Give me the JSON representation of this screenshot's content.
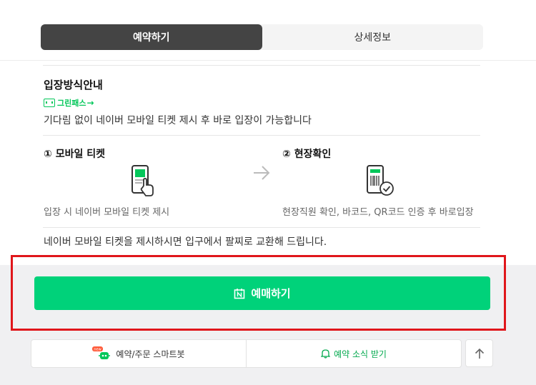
{
  "tabs": [
    {
      "label": "예약하기",
      "active": true
    },
    {
      "label": "상세정보",
      "active": false
    }
  ],
  "entry": {
    "title": "입장방식안내",
    "badge": "그린패스",
    "description": "기다림 없이 네이버 모바일 티켓 제시 후 바로 입장이 가능합니다",
    "steps": [
      {
        "title": "① 모바일 티켓",
        "desc": "입장 시 네이버 모바일 티켓 제시",
        "icon": "mobile-ticket-icon"
      },
      {
        "title": "② 현장확인",
        "desc": "현장직원 확인, 바코드, QR코드 인증 후 바로입장",
        "icon": "barcode-check-icon"
      }
    ],
    "notice": "네이버 모바일 티켓을 제시하시면 입구에서 팔찌로 교환해 드립니다."
  },
  "actions": {
    "reserve_label": "예매하기",
    "smartbot_label": "예약/주문 스마트봇",
    "smartbot_badge": "new",
    "notify_label": "예약 소식 받기"
  },
  "colors": {
    "accent": "#00d27a",
    "tab_active": "#444444",
    "highlight": "#e0161b"
  }
}
